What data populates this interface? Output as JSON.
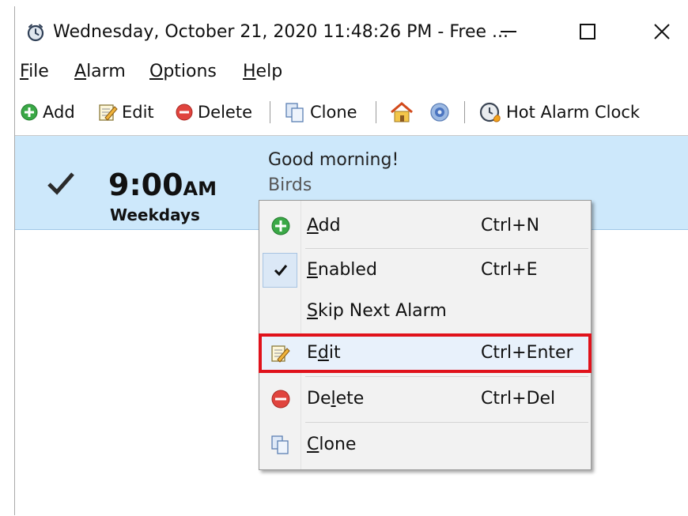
{
  "window": {
    "title": "Wednesday, October 21, 2020 11:48:26 PM - Free ...",
    "controls": {
      "minimize": "—",
      "maximize": "☐",
      "close": "✕"
    }
  },
  "menu": [
    {
      "label_first": "F",
      "label_rest": "ile"
    },
    {
      "label_first": "A",
      "label_rest": "larm"
    },
    {
      "label_first": "O",
      "label_rest": "ptions"
    },
    {
      "label_first": "H",
      "label_rest": "elp"
    }
  ],
  "toolbar": {
    "add": "Add",
    "edit": "Edit",
    "delete": "Delete",
    "clone": "Clone",
    "hot_alarm_clock": "Hot Alarm Clock"
  },
  "alarm": {
    "enabled": true,
    "time": "9:00",
    "ampm": "AM",
    "days": "Weekdays",
    "message": "Good morning!",
    "sound": "Birds"
  },
  "context_menu": {
    "items": [
      {
        "pre": "",
        "u": "A",
        "post": "dd",
        "shortcut": "Ctrl+N"
      },
      {
        "pre": "",
        "u": "E",
        "post": "nabled",
        "shortcut": "Ctrl+E",
        "checked": true
      },
      {
        "pre": "",
        "u": "S",
        "post": "kip Next Alarm",
        "shortcut": ""
      },
      {
        "pre": "E",
        "u": "d",
        "post": "it",
        "shortcut": "Ctrl+Enter",
        "highlighted": true
      },
      {
        "pre": "De",
        "u": "l",
        "post": "ete",
        "shortcut": "Ctrl+Del"
      },
      {
        "pre": "",
        "u": "C",
        "post": "lone",
        "shortcut": ""
      }
    ]
  },
  "colors": {
    "selected_row": "#cde8fb",
    "highlight_border": "#e0121b",
    "add_green": "#3aa846",
    "delete_red": "#e0443e"
  }
}
